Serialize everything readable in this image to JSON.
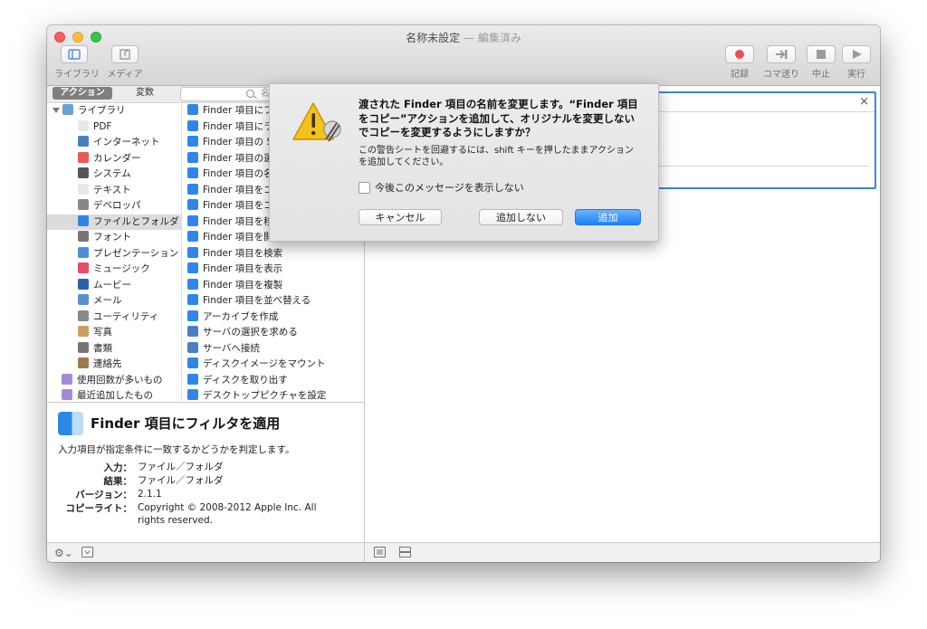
{
  "window": {
    "title": "名称未設定",
    "title_separator": "—",
    "title_status": "編集済み"
  },
  "toolbar": {
    "library": "ライブラリ",
    "media": "メディア",
    "record": "記録",
    "step": "コマ送り",
    "stop": "中止",
    "run": "実行"
  },
  "tabs": {
    "actions": "アクション",
    "variables": "変数",
    "search_placeholder": "名"
  },
  "library": {
    "items": [
      {
        "label": "ライブラリ",
        "icon": "library-icon",
        "level": 0
      },
      {
        "label": "PDF",
        "icon": "pdf-icon",
        "level": 1
      },
      {
        "label": "インターネット",
        "icon": "globe-icon",
        "level": 1
      },
      {
        "label": "カレンダー",
        "icon": "calendar-icon",
        "level": 1
      },
      {
        "label": "システム",
        "icon": "system-icon",
        "level": 1
      },
      {
        "label": "テキスト",
        "icon": "text-icon",
        "level": 1
      },
      {
        "label": "デベロッパ",
        "icon": "tools-icon",
        "level": 1
      },
      {
        "label": "ファイルとフォルダ",
        "icon": "finder-icon",
        "level": 1,
        "selected": true
      },
      {
        "label": "フォント",
        "icon": "font-icon",
        "level": 1
      },
      {
        "label": "プレゼンテーション",
        "icon": "keynote-icon",
        "level": 1
      },
      {
        "label": "ミュージック",
        "icon": "music-icon",
        "level": 1
      },
      {
        "label": "ムービー",
        "icon": "quicktime-icon",
        "level": 1
      },
      {
        "label": "メール",
        "icon": "mail-icon",
        "level": 1
      },
      {
        "label": "ユーティリティ",
        "icon": "utilities-icon",
        "level": 1
      },
      {
        "label": "写真",
        "icon": "photos-icon",
        "level": 1
      },
      {
        "label": "書類",
        "icon": "documents-icon",
        "level": 1
      },
      {
        "label": "連絡先",
        "icon": "contacts-icon",
        "level": 1
      },
      {
        "label": "使用回数が多いもの",
        "icon": "smart-folder-icon",
        "level": 0
      },
      {
        "label": "最近追加したもの",
        "icon": "smart-folder-icon",
        "level": 0
      }
    ]
  },
  "actions": {
    "items": [
      {
        "label": "Finder 項目にフ",
        "icon": "finder-icon"
      },
      {
        "label": "Finder 項目にラ",
        "icon": "finder-icon"
      },
      {
        "label": "Finder 項目の S",
        "icon": "finder-icon"
      },
      {
        "label": "Finder 項目の選",
        "icon": "finder-icon"
      },
      {
        "label": "Finder 項目の名",
        "icon": "finder-icon"
      },
      {
        "label": "Finder 項目をコ",
        "icon": "finder-icon"
      },
      {
        "label": "Finder 項目をコ",
        "icon": "finder-icon"
      },
      {
        "label": "Finder 項目を移",
        "icon": "finder-icon"
      },
      {
        "label": "Finder 項目を開",
        "icon": "finder-icon"
      },
      {
        "label": "Finder 項目を検索",
        "icon": "finder-icon"
      },
      {
        "label": "Finder 項目を表示",
        "icon": "finder-icon"
      },
      {
        "label": "Finder 項目を複製",
        "icon": "finder-icon"
      },
      {
        "label": "Finder 項目を並べ替える",
        "icon": "finder-icon"
      },
      {
        "label": "アーカイブを作成",
        "icon": "finder-icon"
      },
      {
        "label": "サーバの選択を求める",
        "icon": "globe-icon"
      },
      {
        "label": "サーバへ接続",
        "icon": "globe-icon"
      },
      {
        "label": "ディスクイメージをマウント",
        "icon": "finder-icon"
      },
      {
        "label": "ディスクを取り出す",
        "icon": "finder-icon"
      },
      {
        "label": "デスクトップピクチャを設定",
        "icon": "finder-icon"
      }
    ]
  },
  "description": {
    "title": "Finder 項目にフィルタを適用",
    "summary": "入力項目が指定条件に一致するかどうかを判定します。",
    "input_label": "入力：",
    "input_value": "ファイル／フォルダ",
    "result_label": "結果：",
    "result_value": "ファイル／フォルダ",
    "version_label": "バージョン：",
    "version_value": "2.1.1",
    "copyright_label": "コピーライト：",
    "copyright_value": "Copyright © 2008-2012 Apple Inc.  All rights reserved."
  },
  "alert": {
    "title": "渡された Finder 項目の名前を変更します。“Finder 項目をコピー”アクションを追加して、オリジナルを変更しないでコピーを変更するようにしますか？",
    "message": "この警告シートを回避するには、shift キーを押したままアクションを追加してください。",
    "checkbox_label": "今後このメッセージを表示しない",
    "cancel": "キャンセル",
    "dont_add": "追加しない",
    "add": "追加"
  },
  "colors": {
    "accent": "#1a82fb",
    "workflow_border": "#3d86d9"
  }
}
